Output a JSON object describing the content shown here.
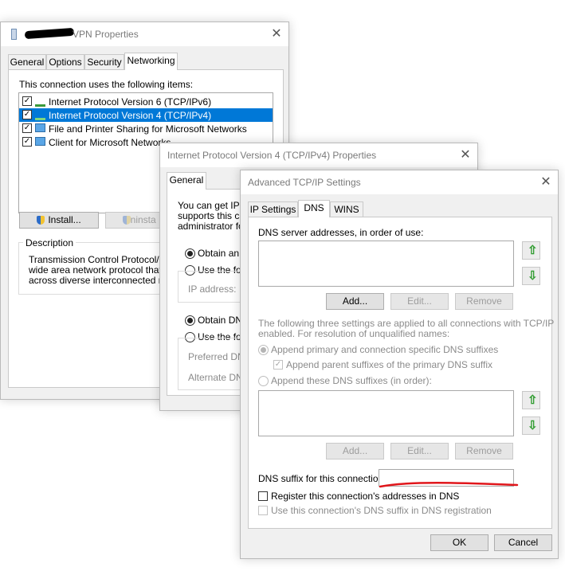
{
  "vpn": {
    "title": "VPN Properties",
    "tabs": [
      "General",
      "Options",
      "Security",
      "Networking"
    ],
    "items_label": "This connection uses the following items:",
    "items": [
      {
        "label": "Internet Protocol Version 6 (TCP/IPv6)",
        "checked": true
      },
      {
        "label": "Internet Protocol Version 4 (TCP/IPv4)",
        "checked": true
      },
      {
        "label": "File and Printer Sharing for Microsoft Networks",
        "checked": true
      },
      {
        "label": "Client for Microsoft Networks",
        "checked": true
      }
    ],
    "install_button": "Install...",
    "uninstall_button": "Uninsta",
    "description_label": "Description",
    "description_lines": [
      "Transmission Control Protocol/Inter",
      "wide area network protocol that pro",
      "across diverse interconnected netw"
    ]
  },
  "ipv4": {
    "title": "Internet Protocol Version 4 (TCP/IPv4) Properties",
    "tab": "General",
    "intro_lines": [
      "You can get IP s",
      "supports this cap",
      "administrator for t"
    ],
    "obtain_ip": "Obtain an IP",
    "use_following_ip": "Use the follo",
    "ip_address_label": "IP address:",
    "obtain_dns": "Obtain DNS",
    "use_following_dns": "Use the follo",
    "preferred_dns_label": "Preferred DNS",
    "alternate_dns_label": "Alternate DNS"
  },
  "advanced": {
    "title": "Advanced TCP/IP Settings",
    "tabs": [
      "IP Settings",
      "DNS",
      "WINS"
    ],
    "dns_servers_label": "DNS server addresses, in order of use:",
    "add_button": "Add...",
    "edit_button": "Edit...",
    "remove_button": "Remove",
    "info_line1": "The following three settings are applied to all connections with TCP/IP",
    "info_line2": "enabled. For resolution of unqualified names:",
    "append_primary": "Append primary and connection specific DNS suffixes",
    "append_parent": "Append parent suffixes of the primary DNS suffix",
    "append_these": "Append these DNS suffixes (in order):",
    "dns_suffix_label": "DNS suffix for this connection:",
    "dns_suffix_value": "",
    "register_label": "Register this connection's addresses in DNS",
    "use_suffix_label": "Use this connection's DNS suffix in DNS registration",
    "ok_button": "OK",
    "cancel_button": "Cancel"
  },
  "colors": {
    "selection": "#0078d7",
    "annotation": "#e0161b",
    "arrow": "#2e9b2e"
  }
}
